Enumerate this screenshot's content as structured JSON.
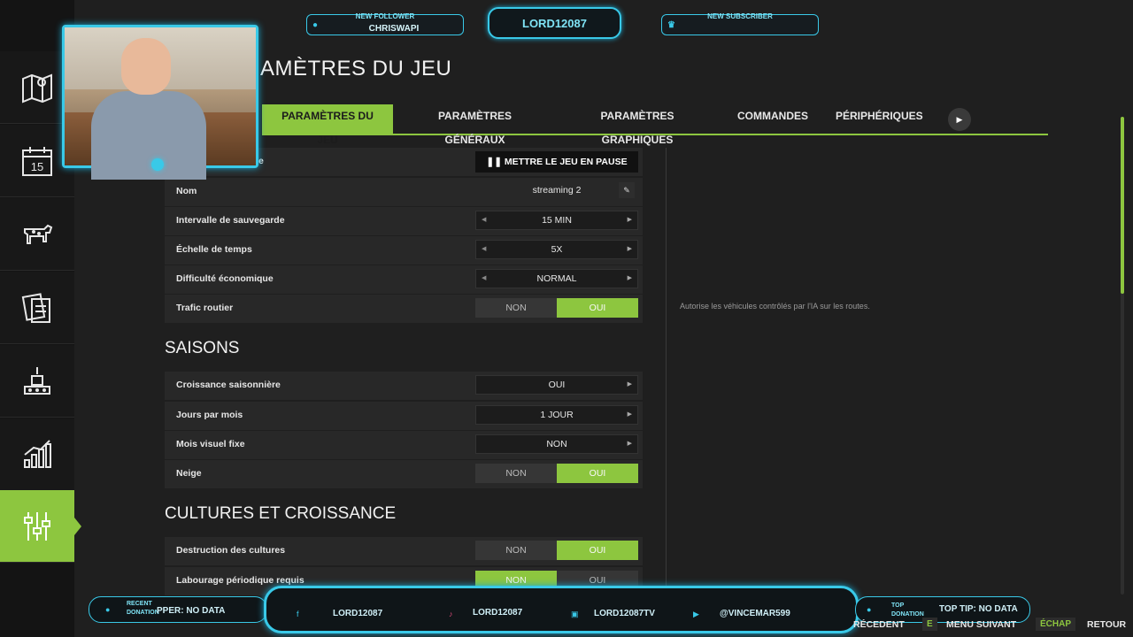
{
  "overlay": {
    "new_follower_label": "NEW FOLLOWER",
    "new_follower_name": "CHRISWAPI",
    "channel_name": "LORD12087",
    "new_subscriber_label": "NEW SUBSCRIBER",
    "bottom": {
      "recent_donation_label_1": "RECENT",
      "recent_donation_label_2": "DONATION",
      "recent_donation_value": "PPER: NO DATA",
      "facebook": "LORD12087",
      "tiktok": "LORD12087",
      "twitch": "LORD12087TV",
      "youtube": "@VINCEMAR599",
      "top_donation_label_1": "TOP",
      "top_donation_label_2": "DONATION",
      "top_tip": "TOP TIP: NO DATA"
    }
  },
  "page": {
    "title": "AMÈTRES DU JEU"
  },
  "tabs": [
    {
      "label": "PARAMÈTRES DU JEU"
    },
    {
      "label": "PARAMÈTRES GÉNÉRAUX"
    },
    {
      "label": "PARAMÈTRES GRAPHIQUES"
    },
    {
      "label": "COMMANDES"
    },
    {
      "label": "PÉRIPHÉRIQUES"
    }
  ],
  "first_row": {
    "label_fragment": "e",
    "pause_button": "METTRE LE JEU EN PAUSE"
  },
  "game_settings": [
    {
      "label": "Nom",
      "value": "streaming 2"
    },
    {
      "label": "Intervalle de sauvegarde",
      "value": "15 MIN"
    },
    {
      "label": "Échelle de temps",
      "value": "5X"
    },
    {
      "label": "Difficulté économique",
      "value": "NORMAL"
    },
    {
      "label": "Trafic routier",
      "off": "NON",
      "on": "OUI"
    }
  ],
  "seasons": {
    "title": "SAISONS",
    "rows": [
      {
        "label": "Croissance saisonnière",
        "value": "OUI"
      },
      {
        "label": "Jours par mois",
        "value": "1 JOUR"
      },
      {
        "label": "Mois visuel fixe",
        "value": "NON"
      },
      {
        "label": "Neige",
        "off": "NON",
        "on": "OUI"
      }
    ]
  },
  "crops": {
    "title": "CULTURES ET CROISSANCE",
    "rows": [
      {
        "label": "Destruction des cultures",
        "off": "NON",
        "on": "OUI"
      },
      {
        "label": "Labourage périodique requis",
        "off": "NON",
        "on": "OUI"
      }
    ]
  },
  "help_text": "Autorise les véhicules contrôlés par l'IA sur les routes.",
  "hints": {
    "prev": "RÉCEDENT",
    "next_key": "E",
    "next": "MENU SUIVANT",
    "back_key": "ÉCHAP",
    "back": "RETOUR"
  },
  "colors": {
    "accent": "#8dc63f",
    "overlay": "#39c9e8"
  }
}
